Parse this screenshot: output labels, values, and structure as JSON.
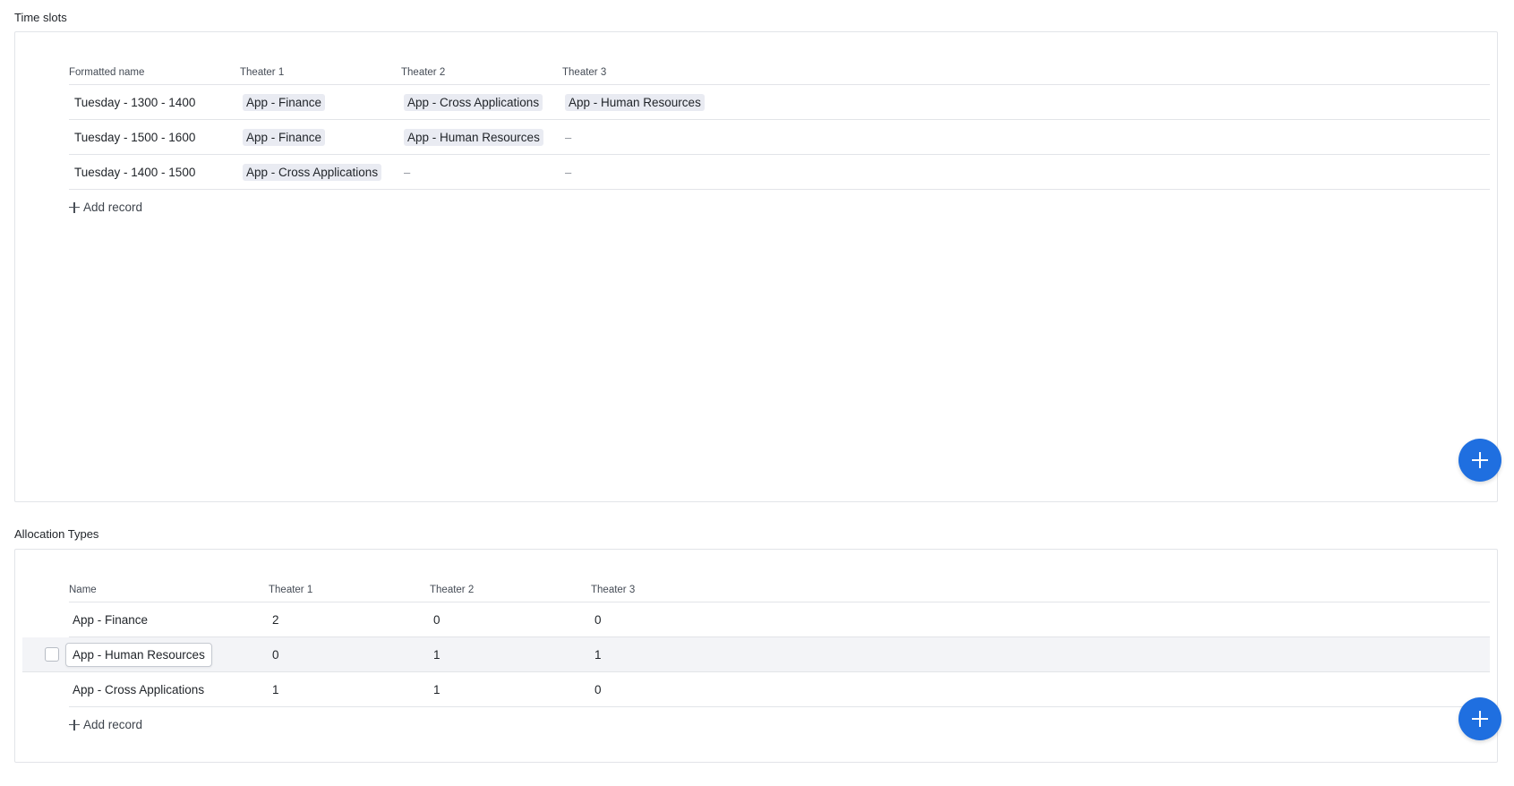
{
  "time_slots": {
    "title": "Time slots",
    "columns": [
      "Formatted name",
      "Theater 1",
      "Theater 2",
      "Theater 3"
    ],
    "rows": [
      {
        "name": "Tuesday - 1300 - 1400",
        "t1": "App - Finance",
        "t2": "App - Cross Applications",
        "t3": "App - Human Resources"
      },
      {
        "name": "Tuesday - 1500 - 1600",
        "t1": "App - Finance",
        "t2": "App - Human Resources",
        "t3": "–"
      },
      {
        "name": "Tuesday - 1400 - 1500",
        "t1": "App - Cross Applications",
        "t2": "–",
        "t3": "–"
      }
    ],
    "add_record_label": "Add record"
  },
  "allocation_types": {
    "title": "Allocation Types",
    "columns": [
      "Name",
      "Theater 1",
      "Theater 2",
      "Theater 3"
    ],
    "rows": [
      {
        "name": "App - Finance",
        "t1": "2",
        "t2": "0",
        "t3": "0"
      },
      {
        "name": "App - Human Resources",
        "t1": "0",
        "t2": "1",
        "t3": "1"
      },
      {
        "name": "App - Cross Applications",
        "t1": "1",
        "t2": "1",
        "t3": "0"
      }
    ],
    "add_record_label": "Add record"
  },
  "colors": {
    "accent": "#1f6fe0",
    "chip_bg": "#e9ebf2",
    "border": "#e2e4e8"
  }
}
